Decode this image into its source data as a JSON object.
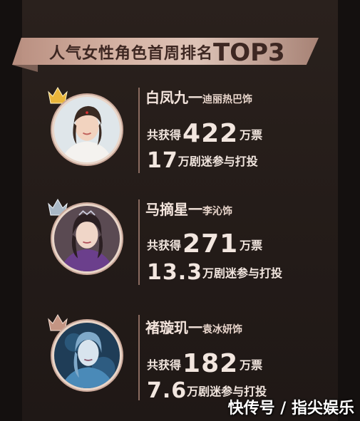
{
  "title": {
    "prefix": "人气女性角色首周排名",
    "suffix": "TOP3"
  },
  "entries": [
    {
      "role": "白凤九",
      "dash": "一",
      "actor": "迪丽热巴饰",
      "votes_label": "共获得",
      "votes": "422",
      "votes_unit": "万票",
      "fans": "17",
      "fans_suffix": "万剧迷参与打投",
      "crown_color": "#e9b53a"
    },
    {
      "role": "马摘星",
      "dash": "一",
      "actor": "李沁饰",
      "votes_label": "共获得",
      "votes": "271",
      "votes_unit": "万票",
      "fans": "13.3",
      "fans_suffix": "万剧迷参与打投",
      "crown_color": "#a9b8c6"
    },
    {
      "role": "褚璇玑",
      "dash": "一",
      "actor": "袁冰妍饰",
      "votes_label": "共获得",
      "votes": "182",
      "votes_unit": "万票",
      "fans": "7.6",
      "fans_suffix": "万剧迷参与打投",
      "crown_color": "#c49583"
    }
  ],
  "watermark": "快传号 / 指尖娱乐"
}
